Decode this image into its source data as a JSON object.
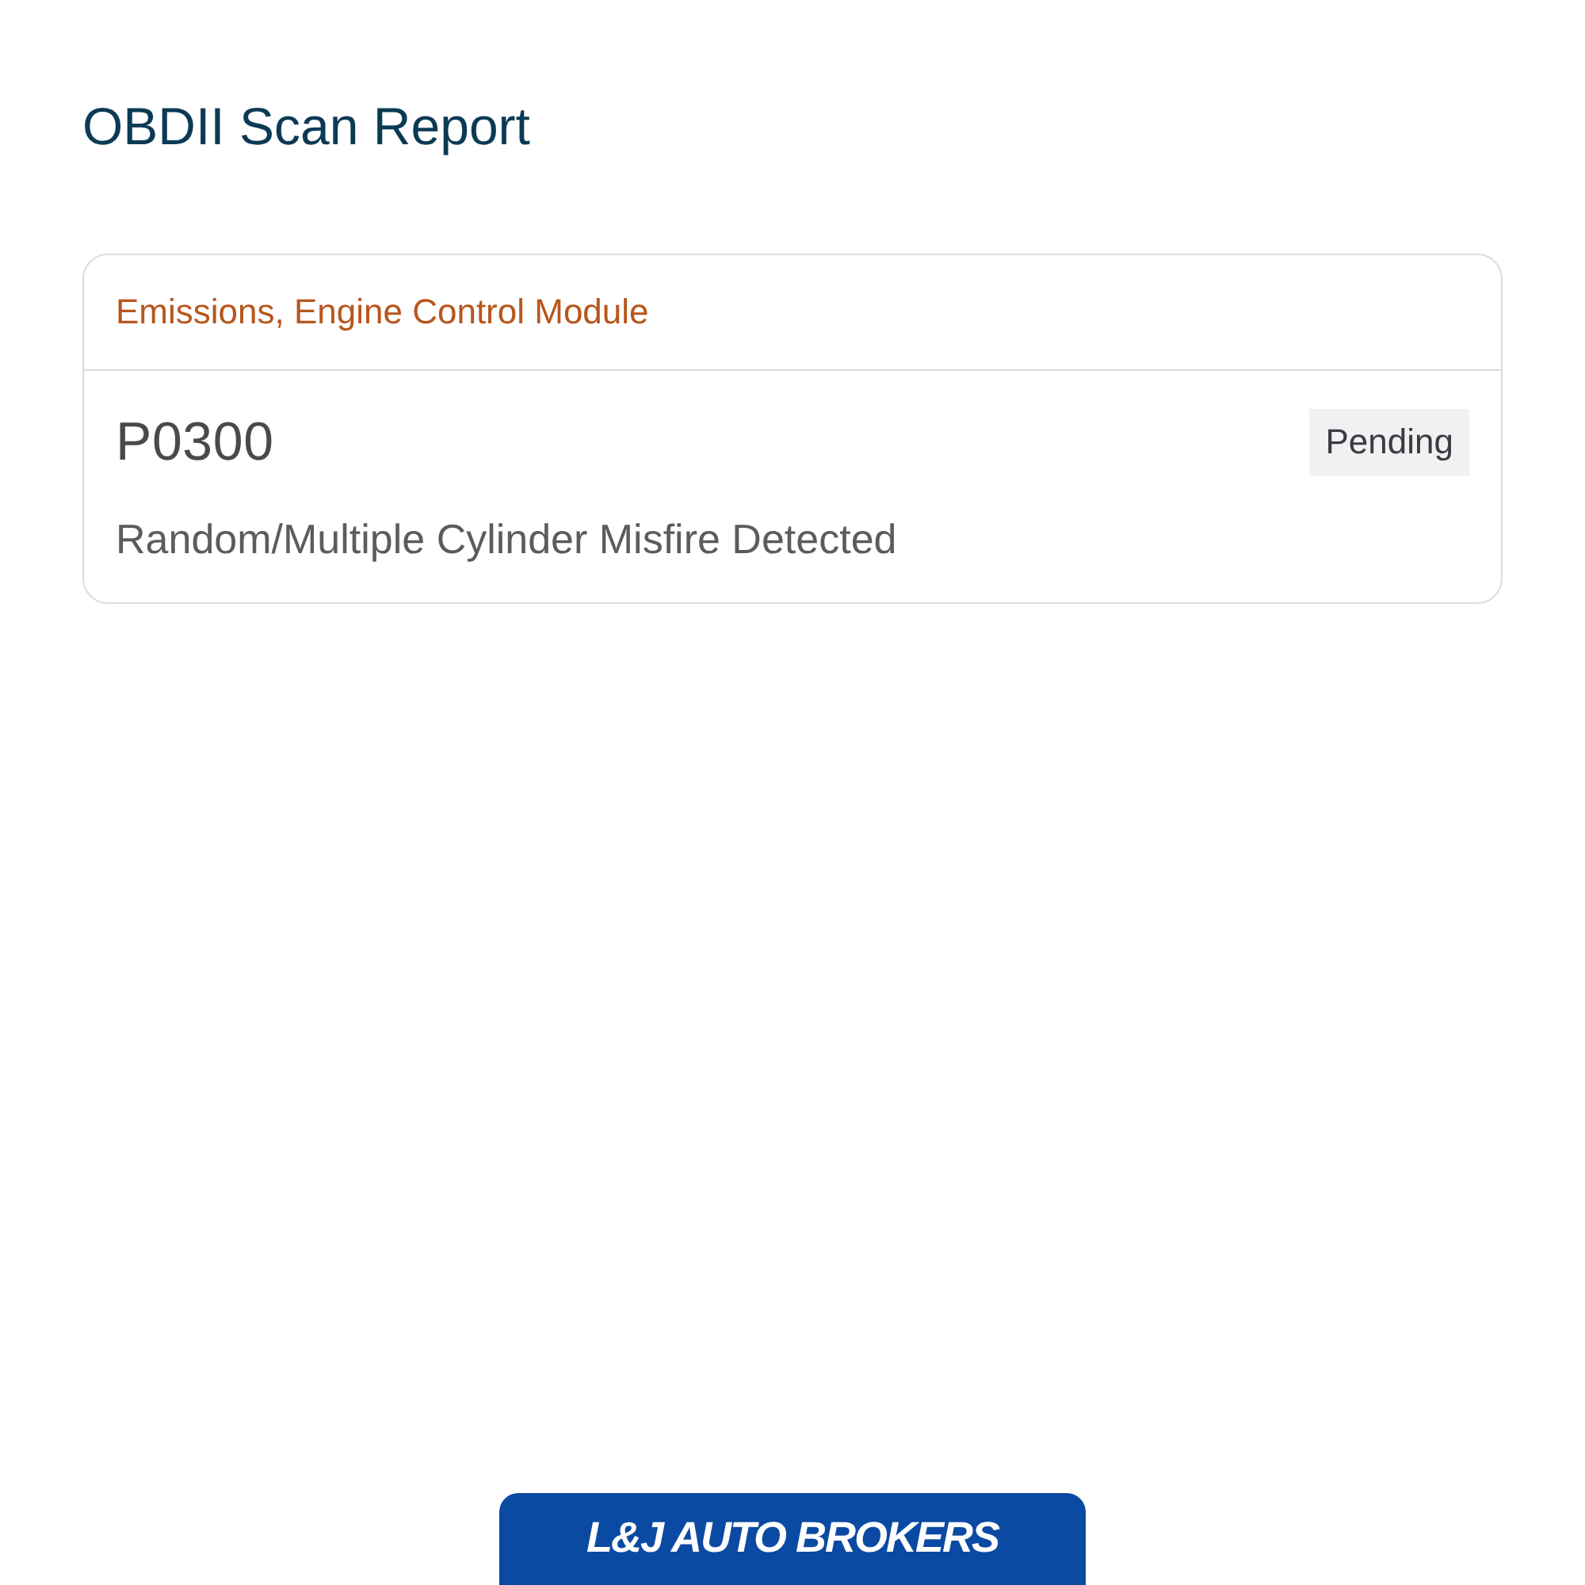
{
  "title": "OBDII Scan Report",
  "trouble_codes": [
    {
      "module": "Emissions, Engine Control Module",
      "code": "P0300",
      "status": "Pending",
      "description": "Random/Multiple Cylinder Misfire Detected"
    }
  ],
  "footer": {
    "logo_text": "L&J AUTO BROKERS"
  }
}
